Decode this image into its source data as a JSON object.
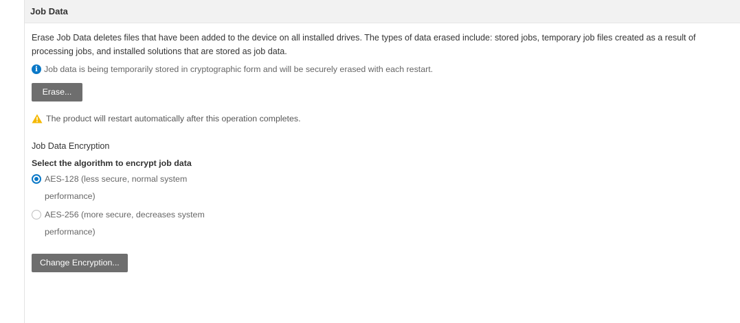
{
  "section": {
    "title": "Job Data",
    "description": "Erase Job Data deletes files that have been added to the device on all installed drives. The types of data erased include: stored jobs, temporary job files created as a result of processing jobs, and installed solutions that are stored as job data.",
    "info_text": "Job data is being temporarily stored in cryptographic form and will be securely erased with each restart.",
    "info_icon": "info-icon",
    "erase_button": "Erase...",
    "warning_text": "The product will restart automatically after this operation completes.",
    "warning_icon": "warning-icon"
  },
  "encryption": {
    "title": "Job Data Encryption",
    "select_label": "Select the algorithm to encrypt job data",
    "options": [
      {
        "label": "AES-128 (less secure, normal system performance)",
        "selected": true
      },
      {
        "label": "AES-256 (more secure, decreases system performance)",
        "selected": false
      }
    ],
    "change_button": "Change Encryption..."
  },
  "colors": {
    "accent": "#0a78c7",
    "button_bg": "#6e6e6e",
    "warning": "#f5b800",
    "header_bg": "#f2f2f2"
  }
}
